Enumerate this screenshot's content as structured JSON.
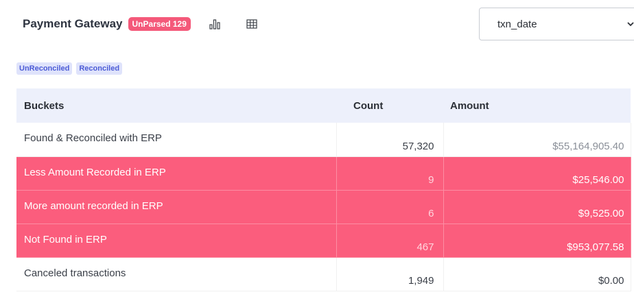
{
  "header": {
    "title": "Payment Gateway",
    "unparsed_badge": "UnParsed 129"
  },
  "select": {
    "value": "txn_date"
  },
  "chips": [
    "UnReconciled",
    "Reconciled"
  ],
  "table": {
    "columns": [
      "Buckets",
      "Count",
      "Amount"
    ],
    "rows": [
      {
        "bucket": "Found & Reconciled with ERP",
        "count": "57,320",
        "amount": "$55,164,905.40",
        "status": "normal"
      },
      {
        "bucket": "Less Amount Recorded in ERP",
        "count": "9",
        "amount": "$25,546.00",
        "status": "highlight"
      },
      {
        "bucket": "More amount recorded in ERP",
        "count": "6",
        "amount": "$9,525.00",
        "status": "highlight"
      },
      {
        "bucket": "Not Found in ERP",
        "count": "467",
        "amount": "$953,077.58",
        "status": "highlight"
      },
      {
        "bucket": "Canceled transactions",
        "count": "1,949",
        "amount": "$0.00",
        "status": "normal"
      }
    ]
  },
  "colors": {
    "highlight_row": "#fb5d7d",
    "badge": "#f4597a",
    "chip_bg": "#dfe3fb",
    "chip_text": "#4b5bd6",
    "header_bg": "#edf0fb"
  },
  "icons": {
    "chart": "bar-chart-icon",
    "table": "grid-table-icon",
    "dropdown": "chevron-down-icon"
  }
}
